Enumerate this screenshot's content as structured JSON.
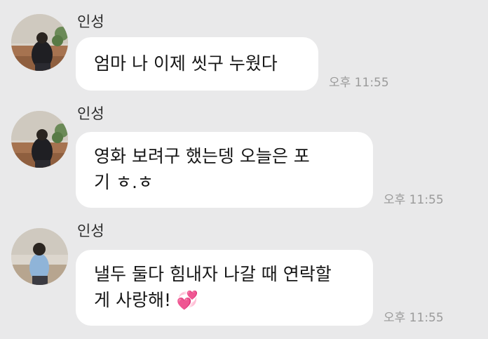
{
  "messages": [
    {
      "sender": "인성",
      "lines": [
        "엄마 나 이제 씻구 누웠다"
      ],
      "time": "오후 11:55"
    },
    {
      "sender": "인성",
      "lines": [
        "영화 보려구 했는뎅 오늘은 포",
        "기 ㅎ.ㅎ"
      ],
      "time": "오후 11:55"
    },
    {
      "sender": "인성",
      "lines": [
        "낼두 둘다 힘내자 나갈 때 연락할",
        "게 사랑해! 💞"
      ],
      "time": "오후 11:55"
    }
  ],
  "icons": {
    "avatar": "profile-photo",
    "emoji": "two-hearts-emoji"
  },
  "colors": {
    "background": "#e9e9ea",
    "bubble": "#ffffff",
    "timestamp": "#9a9a9a",
    "heart": "#e75a9c"
  }
}
